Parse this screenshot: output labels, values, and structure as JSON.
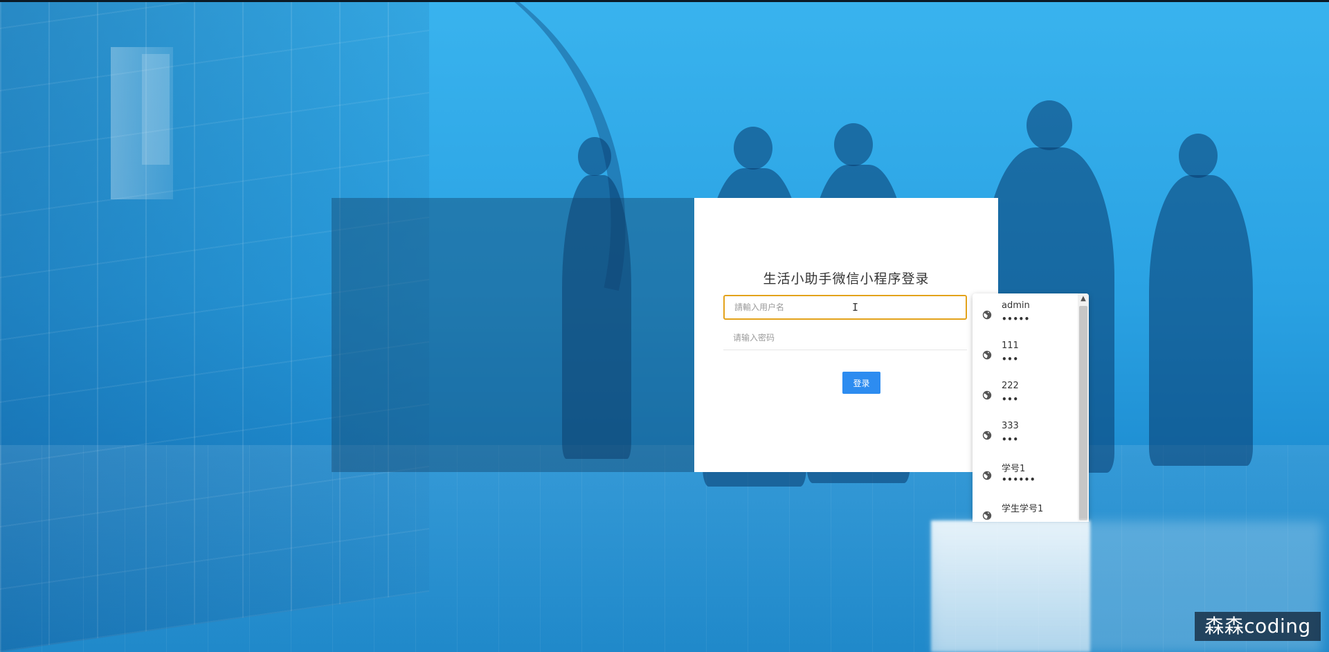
{
  "login": {
    "title": "生活小助手微信小程序登录",
    "username_placeholder": "請輸入用户名",
    "password_placeholder": "请输入密码",
    "login_button": "登录"
  },
  "autocomplete": {
    "items": [
      {
        "username": "admin",
        "password_mask": "•••••"
      },
      {
        "username": "111",
        "password_mask": "•••"
      },
      {
        "username": "222",
        "password_mask": "•••"
      },
      {
        "username": "333",
        "password_mask": "•••"
      },
      {
        "username": "学号1",
        "password_mask": "••••••"
      },
      {
        "username": "学生学号1",
        "password_mask": ""
      }
    ],
    "icon": "globe-icon"
  },
  "watermark": {
    "text": "森森coding"
  },
  "colors": {
    "background_blue": "#2ea7e6",
    "focus_border": "#e3a21a",
    "button_blue": "#2d8cf0"
  }
}
